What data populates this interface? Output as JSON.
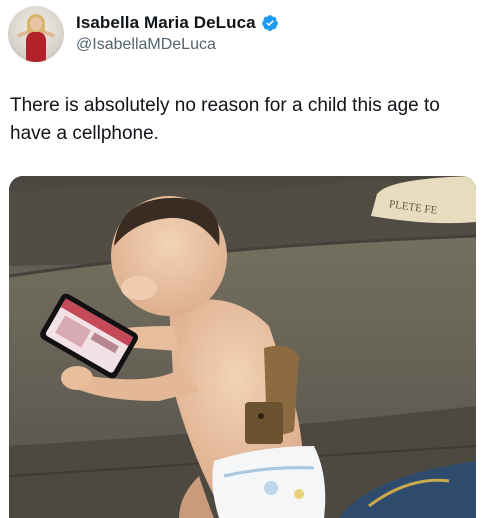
{
  "author": {
    "display_name": "Isabella Maria DeLuca",
    "handle": "@IsabellaMDeLuca",
    "verified": true,
    "verified_color": "#1d9bf0"
  },
  "tweet": {
    "text": "There is absolutely no reason for a child this age to have a cellphone."
  },
  "media": {
    "pillow_text": "PLETE FE",
    "icons": [
      "baby-photo",
      "phone",
      "holster"
    ]
  }
}
